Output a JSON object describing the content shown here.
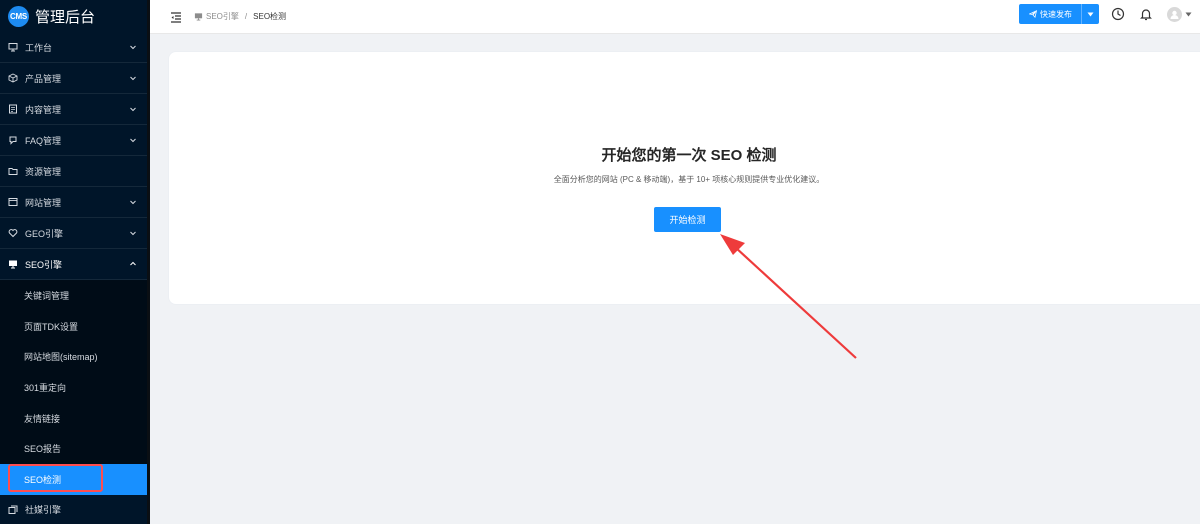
{
  "app": {
    "logo_badge": "CMS",
    "title": "管理后台"
  },
  "sidebar": {
    "items": [
      {
        "label": "工作台",
        "icon": "monitor-icon"
      },
      {
        "label": "产品管理",
        "icon": "cube-icon"
      },
      {
        "label": "内容管理",
        "icon": "document-icon"
      },
      {
        "label": "FAQ管理",
        "icon": "faq-icon"
      },
      {
        "label": "资源管理",
        "icon": "folder-icon"
      },
      {
        "label": "网站管理",
        "icon": "website-icon"
      },
      {
        "label": "GEO引擎",
        "icon": "heart-icon"
      },
      {
        "label": "SEO引擎",
        "icon": "seo-monitor-icon"
      }
    ],
    "sub_items": [
      {
        "label": "关键词管理"
      },
      {
        "label": "页面TDK设置"
      },
      {
        "label": "网站地图(sitemap)"
      },
      {
        "label": "301重定向"
      },
      {
        "label": "友情链接"
      },
      {
        "label": "SEO报告"
      },
      {
        "label": "SEO检测"
      }
    ],
    "last_item": {
      "label": "社媒引擎",
      "icon": "share-icon"
    }
  },
  "header": {
    "breadcrumb": {
      "parent": "SEO引擎",
      "separator": "/",
      "current": "SEO检测"
    },
    "quick_publish": "快速发布"
  },
  "main": {
    "title": "开始您的第一次 SEO 检测",
    "subtitle": "全面分析您的网站 (PC & 移动端)，基于 10+ 项核心规则提供专业优化建议。",
    "start_button": "开始检测"
  },
  "colors": {
    "sidebar_bg": "#001529",
    "accent": "#1890ff",
    "highlight": "#ff4d4f"
  }
}
